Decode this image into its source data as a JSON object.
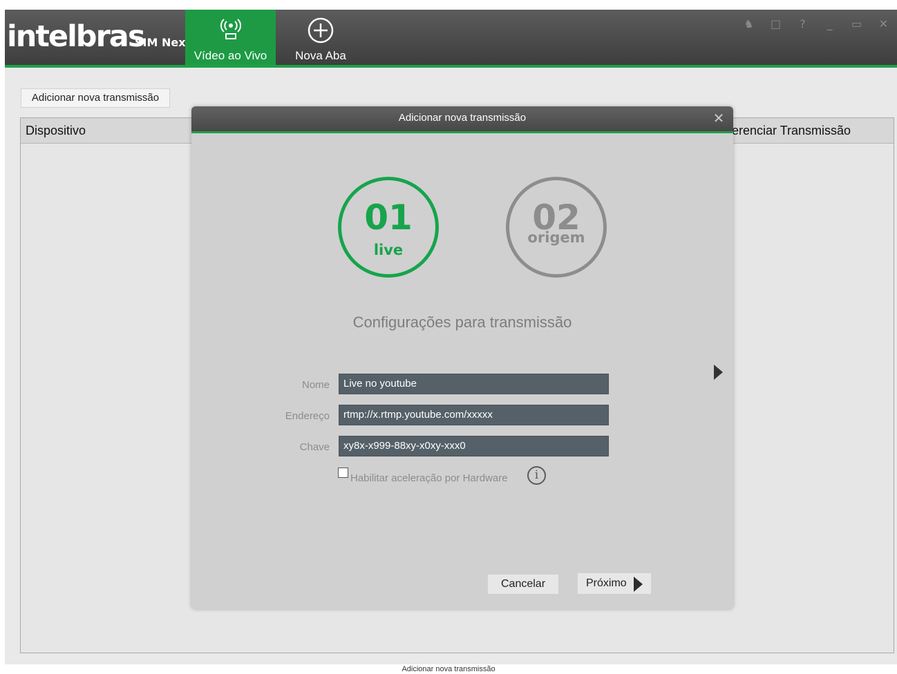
{
  "app": {
    "logo": "intelbras",
    "logo_sub": "SIM Next",
    "tabs": [
      {
        "label": "Vídeo ao Vivo",
        "icon": "live-broadcast-icon",
        "active": true
      },
      {
        "label": "Nova Aba",
        "icon": "plus-circle-icon",
        "active": false
      }
    ],
    "window_controls": [
      "user-icon",
      "lock-icon",
      "help-icon",
      "minimize-icon",
      "maximize-icon",
      "close-icon"
    ]
  },
  "main": {
    "add_button": "Adicionar nova transmissão",
    "columns": [
      "Dispositivo",
      "erenciar Transmissão"
    ]
  },
  "dialog": {
    "title": "Adicionar nova transmissão",
    "steps": [
      {
        "number": "01",
        "label": "live",
        "active": true,
        "color": "#17a44c"
      },
      {
        "number": "02",
        "label": "origem",
        "active": false,
        "color": "#8d8d8d"
      }
    ],
    "config_title": "Configurações para transmissão",
    "fields": {
      "nome": {
        "label": "Nome",
        "value": "Live no youtube"
      },
      "endereco": {
        "label": "Endereço",
        "value": "rtmp://x.rtmp.youtube.com/xxxxx"
      },
      "chave": {
        "label": "Chave",
        "value": "xy8x-x999-88xy-x0xy-xxx0"
      }
    },
    "hw_accel": {
      "label": "Habilitar aceleração por Hardware",
      "checked": false
    },
    "cancel_label": "Cancelar",
    "next_label": "Próximo"
  },
  "caption": "Adicionar nova transmissão",
  "colors": {
    "accent": "#1fa048",
    "titlebar": "#4a4a4a",
    "input_bg": "#556068"
  }
}
